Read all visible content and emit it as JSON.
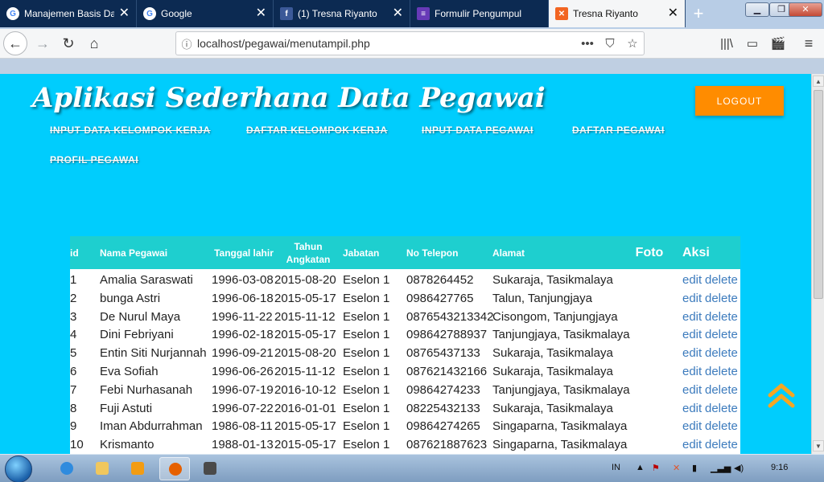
{
  "browser": {
    "tabs": [
      {
        "title": "Manajemen Basis Da",
        "icon": "google-icon"
      },
      {
        "title": "Google",
        "icon": "google-icon"
      },
      {
        "title": "(1) Tresna Riyanto",
        "icon": "facebook-icon"
      },
      {
        "title": "Formulir Pengumpul",
        "icon": "forms-icon"
      },
      {
        "title": "Tresna Riyanto",
        "icon": "xampp-icon"
      }
    ],
    "url": "localhost/pegawai/menutampil.php",
    "page_actions": "•••"
  },
  "app": {
    "title": "Aplikasi Sederhana Data Pegawai",
    "logout": "LOGOUT",
    "menu": [
      "INPUT DATA KELOMPOK KERJA",
      "DAFTAR KELOMPOK KERJA",
      "INPUT DATA PEGAWAI",
      "DAFTAR PEGAWAI",
      "PROFIL PEGAWAI"
    ]
  },
  "table": {
    "headers": {
      "id": "id",
      "nama": "Nama Pegawai",
      "lahir": "Tanggal lahir",
      "angkatan_1": "Tahun",
      "angkatan_2": "Angkatan",
      "jabatan": "Jabatan",
      "telepon": "No Telepon",
      "alamat": "Alamat",
      "foto": "Foto",
      "aksi": "Aksi"
    },
    "rows": [
      {
        "id": "1",
        "nama": "Amalia Saraswati",
        "lahir": "1996-03-08",
        "angkatan": "2015-08-20",
        "jabatan": "Eselon 1",
        "telepon": "0878264452",
        "alamat": "Sukaraja, Tasikmalaya",
        "edit": "edit",
        "delete": "delete"
      },
      {
        "id": "2",
        "nama": "bunga Astri",
        "lahir": "1996-06-18",
        "angkatan": "2015-05-17",
        "jabatan": "Eselon 1",
        "telepon": "0986427765",
        "alamat": "Talun, Tanjungjaya",
        "edit": "edit",
        "delete": "delete"
      },
      {
        "id": "3",
        "nama": "De Nurul Maya",
        "lahir": "1996-11-22",
        "angkatan": "2015-11-12",
        "jabatan": "Eselon 1",
        "telepon": "0876543213342",
        "alamat": "Cisongom, Tanjungjaya",
        "edit": "edit",
        "delete": "delete"
      },
      {
        "id": "4",
        "nama": "Dini Febriyani",
        "lahir": "1996-02-18",
        "angkatan": "2015-05-17",
        "jabatan": "Eselon 1",
        "telepon": "098642788937",
        "alamat": "Tanjungjaya, Tasikmalaya",
        "edit": "edit",
        "delete": "delete"
      },
      {
        "id": "5",
        "nama": "Entin Siti Nurjannah",
        "lahir": "1996-09-21",
        "angkatan": "2015-08-20",
        "jabatan": "Eselon 1",
        "telepon": "08765437133",
        "alamat": "Sukaraja, Tasikmalaya",
        "edit": "edit",
        "delete": "delete"
      },
      {
        "id": "6",
        "nama": "Eva Sofiah",
        "lahir": "1996-06-26",
        "angkatan": "2015-11-12",
        "jabatan": "Eselon 1",
        "telepon": "087621432166",
        "alamat": "Sukaraja, Tasikmalaya",
        "edit": "edit",
        "delete": "delete"
      },
      {
        "id": "7",
        "nama": "Febi Nurhasanah",
        "lahir": "1996-07-19",
        "angkatan": "2016-10-12",
        "jabatan": "Eselon 1",
        "telepon": "09864274233",
        "alamat": "Tanjungjaya, Tasikmalaya",
        "edit": "edit",
        "delete": "delete"
      },
      {
        "id": "8",
        "nama": "Fuji Astuti",
        "lahir": "1996-07-22",
        "angkatan": "2016-01-01",
        "jabatan": "Eselon 1",
        "telepon": "08225432133",
        "alamat": "Sukaraja, Tasikmalaya",
        "edit": "edit",
        "delete": "delete"
      },
      {
        "id": "9",
        "nama": "Iman Abdurrahman",
        "lahir": "1986-08-11",
        "angkatan": "2015-05-17",
        "jabatan": "Eselon 1",
        "telepon": "09864274265",
        "alamat": "Singaparna, Tasikmalaya",
        "edit": "edit",
        "delete": "delete"
      },
      {
        "id": "10",
        "nama": "Krismanto",
        "lahir": "1988-01-13",
        "angkatan": "2015-05-17",
        "jabatan": "Eselon 1",
        "telepon": "087621887623",
        "alamat": "Singaparna, Tasikmalaya",
        "edit": "edit",
        "delete": "delete"
      }
    ]
  },
  "taskbar": {
    "language": "IN",
    "clock": "9:16"
  },
  "colors": {
    "page_bg": "#00cdfd",
    "table_header": "#1ecfcf",
    "logout_button": "#ff8c00",
    "link": "#3c7bbd",
    "back_to_top": "#f5a623"
  }
}
